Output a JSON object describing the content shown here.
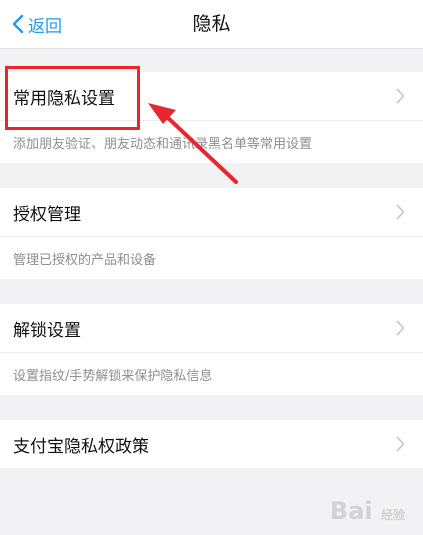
{
  "nav": {
    "back_label": "返回",
    "title": "隐私"
  },
  "sections": [
    {
      "label": "常用隐私设置",
      "description": "添加朋友验证、朋友动态和通讯录黑名单等常用设置"
    },
    {
      "label": "授权管理",
      "description": "管理已授权的产品和设备"
    },
    {
      "label": "解锁设置",
      "description": "设置指纹/手势解锁来保护隐私信息"
    },
    {
      "label": "支付宝隐私权政策",
      "description": ""
    }
  ],
  "watermark": {
    "text": "Bai",
    "sub": "经验"
  },
  "colors": {
    "accent": "#1d9bf0",
    "highlight": "#e8262e",
    "background": "#f2f2f4"
  }
}
